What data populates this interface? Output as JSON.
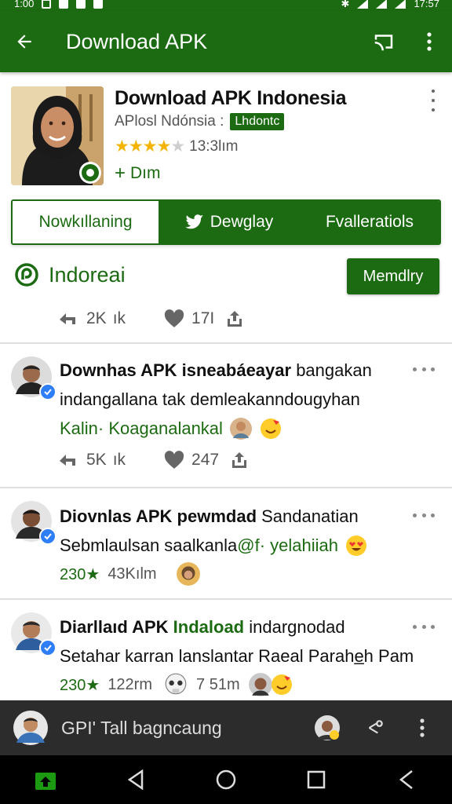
{
  "status_bar": {
    "time_left": "1:00",
    "time_right": "17:57"
  },
  "app_bar": {
    "title": "Download APK",
    "icons": [
      "back-arrow-icon",
      "cast-icon",
      "more-vert-icon"
    ]
  },
  "app": {
    "name": "Download APK Indonesia",
    "developer": "APlosl Ndónsia :",
    "badge": "Lhdontc",
    "rating_stars": 3.5,
    "rating_text": "13:3lım",
    "install_text": "Dım"
  },
  "tabs": [
    {
      "label": "Nowkıllaning"
    },
    {
      "label": "Dewglay"
    },
    {
      "label": "Fvalleratiols"
    }
  ],
  "section": {
    "title": "Indoreai",
    "button": "Memdlry",
    "stats": {
      "reposts": "2K",
      "reposts_suffix": "ık",
      "likes": "17I"
    }
  },
  "posts": [
    {
      "line1_bold": "Downhas APK isneabáeayar",
      "line1_rest": " bangakan",
      "line2": "indangallana tak demleakanndougyhan",
      "line3_green": "Kalin· Koaganalankal",
      "stats": {
        "reposts": "5K",
        "reposts_suffix": "ık",
        "likes": "247"
      }
    },
    {
      "line1_bold": "Diovnlas APK pewmdad",
      "line1_rest": " Sandanatian",
      "line2_a": "Sebmlaulsan saalkanla ",
      "line2_green": "@f· yelahiiah",
      "meta_count": "230★",
      "meta_text": "43Kılm"
    },
    {
      "line1_bold": "Diarllaıd APK ",
      "line1_green": "Indaload",
      "line1_rest": " indargnodad",
      "line2": "Setahar karran lanslantar Raeal Parahe̲h Pam",
      "meta_count": "230★",
      "meta_text": "122rm",
      "meta_text2": "7 51m"
    }
  ],
  "bottom_bar": {
    "title": "GPI' Tall bagncaung"
  }
}
